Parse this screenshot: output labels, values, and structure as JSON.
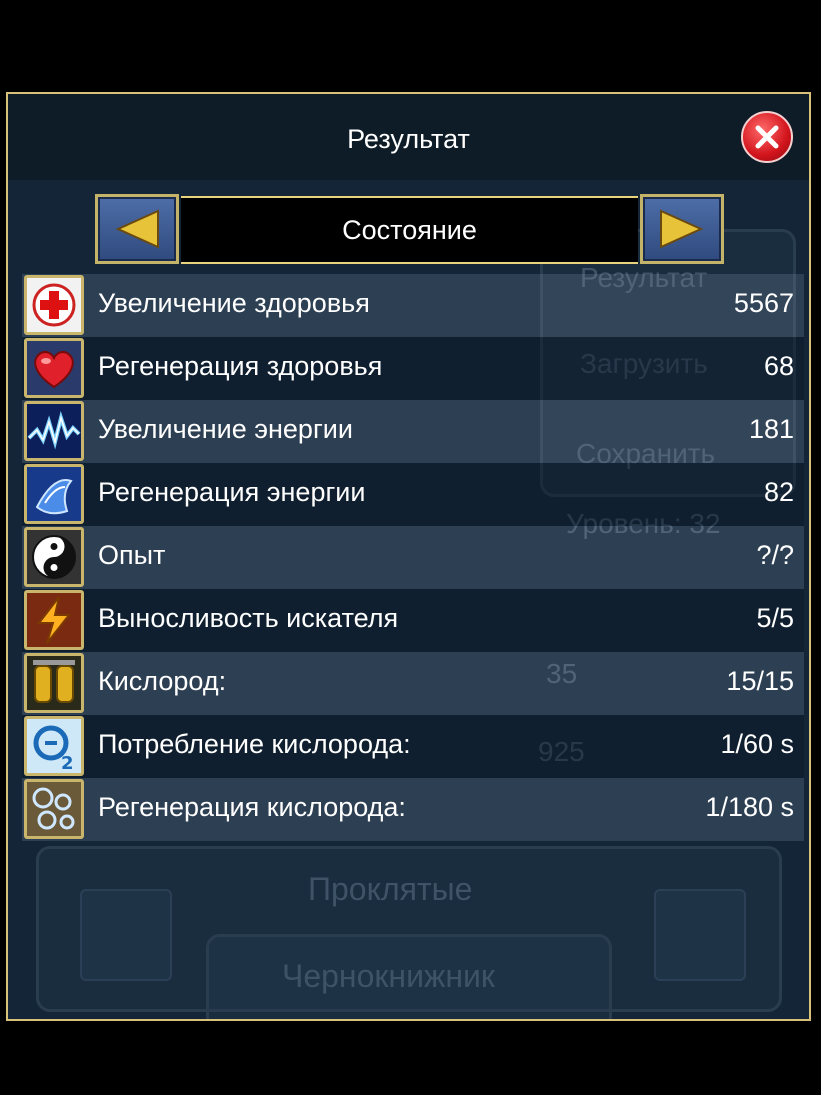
{
  "window": {
    "title": "Результат",
    "close_icon": "close-icon"
  },
  "background": {
    "hp_value": "5567",
    "energy_value": "181",
    "menu_title": "Результат",
    "load_label": "Загрузить",
    "save_label": "Сохранить",
    "level_label": "Уровень: 32",
    "num_a": "35",
    "num_b": "925",
    "faction_label": "Проклятые",
    "class_label": "Чернокнижник"
  },
  "selector": {
    "current": "Состояние"
  },
  "stats": [
    {
      "label": "Увеличение здоровья",
      "value": "5567",
      "icon": "medkit-icon"
    },
    {
      "label": "Регенерация здоровья",
      "value": "68",
      "icon": "heart-icon"
    },
    {
      "label": "Увеличение энергии",
      "value": "181",
      "icon": "energy-wave-icon"
    },
    {
      "label": "Регенерация энергии",
      "value": "82",
      "icon": "energy-crystal-icon"
    },
    {
      "label": "Опыт",
      "value": "?/?",
      "icon": "yin-yang-icon"
    },
    {
      "label": "Выносливость искателя",
      "value": "5/5",
      "icon": "lightning-icon"
    },
    {
      "label": "Кислород:",
      "value": "15/15",
      "icon": "oxygen-tanks-icon"
    },
    {
      "label": "Потребление кислорода:",
      "value": "1/60 s",
      "icon": "o2-icon"
    },
    {
      "label": "Регенерация кислорода:",
      "value": "1/180 s",
      "icon": "bubbles-icon"
    }
  ],
  "colors": {
    "frame_border": "#d8c27a",
    "panel_bg": "#132536",
    "close_red": "#d2141c"
  }
}
